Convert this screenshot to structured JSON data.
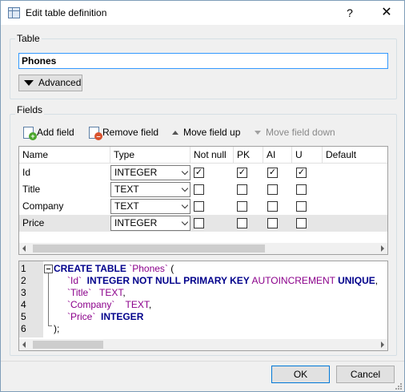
{
  "window": {
    "title": "Edit table definition",
    "help": "?",
    "close": "✕"
  },
  "table_group": {
    "label": "Table",
    "name_value": "Phones",
    "advanced_label": "Advanced"
  },
  "fields_group": {
    "label": "Fields",
    "toolbar": {
      "add": "Add field",
      "remove": "Remove field",
      "move_up": "Move field up",
      "move_down": "Move field down"
    },
    "columns": [
      "Name",
      "Type",
      "Not null",
      "PK",
      "AI",
      "U",
      "Default"
    ],
    "rows": [
      {
        "name": "Id",
        "type": "INTEGER",
        "not_null": true,
        "pk": true,
        "ai": true,
        "u": true
      },
      {
        "name": "Title",
        "type": "TEXT",
        "not_null": false,
        "pk": false,
        "ai": false,
        "u": false
      },
      {
        "name": "Company",
        "type": "TEXT",
        "not_null": false,
        "pk": false,
        "ai": false,
        "u": false
      },
      {
        "name": "Price",
        "type": "INTEGER",
        "not_null": false,
        "pk": false,
        "ai": false,
        "u": false
      }
    ]
  },
  "sql": {
    "line_numbers": [
      "1",
      "2",
      "3",
      "4",
      "5",
      "6"
    ],
    "l1_kw": "CREATE TABLE ",
    "l1_name": "`Phones`",
    "l1_paren": " (",
    "l2_name": "`Id`",
    "l2_kw": "INTEGER NOT NULL PRIMARY KEY",
    "l2_ai": "AUTOINCREMENT",
    "l2_u": "UNIQUE",
    "l2_end": ",",
    "l3_name": "`Title`",
    "l3_type": "TEXT",
    "l3_end": ",",
    "l4_name": "`Company`",
    "l4_type": "TEXT",
    "l4_end": ",",
    "l5_name": "`Price`",
    "l5_type": "INTEGER",
    "l6": ");"
  },
  "buttons": {
    "ok": "OK",
    "cancel": "Cancel"
  },
  "colors": {
    "accent": "#3399ff",
    "keyword": "#00008b",
    "identifier": "#8b008b"
  }
}
